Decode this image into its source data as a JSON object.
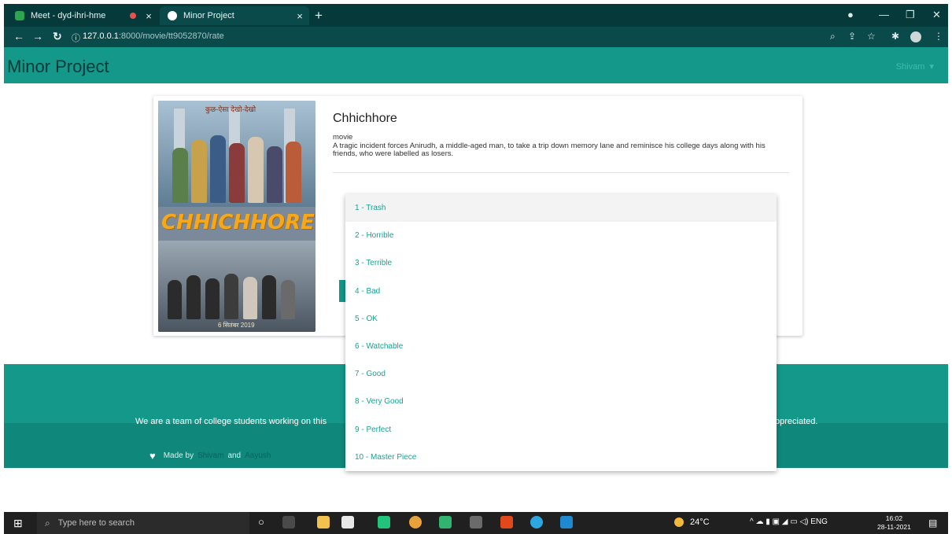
{
  "browser": {
    "tabs": [
      {
        "label": "Meet - dyd-ihri-hme"
      },
      {
        "label": "Minor Project"
      }
    ],
    "url_host": "127.0.0.1",
    "url_path": ":8000/movie/tt9052870/rate",
    "icons": [
      "back-arrow",
      "forward-arrow",
      "reload",
      "info",
      "zoom",
      "share",
      "star",
      "extensions",
      "profile",
      "menu"
    ]
  },
  "app": {
    "brand": "Minor Project",
    "user": "Shivam"
  },
  "movie": {
    "title": "Chhichhore",
    "type": "movie",
    "description": "A tragic incident forces Anirudh, a middle-aged man, to take a trip down memory lane and reminisce his college days along with his friends, who were labelled as losers.",
    "poster": {
      "title": "CHHICHHORE",
      "top_text": "कुछ-ऐसा देखो-देखो",
      "date": "6 सितंबर 2019"
    }
  },
  "rating_options": [
    "1 - Trash",
    "2 - Horrible",
    "3 - Terrible",
    "4 - Bad",
    "5 - OK",
    "6 - Watchable",
    "7 - Good",
    "8 - Very Good",
    "9 - Perfect",
    "10 - Master Piece"
  ],
  "footer": {
    "text_left": "We are a team of college students working on this",
    "text_right": "ppreciated.",
    "made_by": "Made by",
    "author1": "Shivam",
    "and": "and",
    "author2": "Aayush"
  },
  "taskbar": {
    "search_placeholder": "Type here to search",
    "temperature": "24°C",
    "lang": "ENG",
    "time": "16:02",
    "date": "28-11-2021"
  },
  "colors": {
    "primary": "#14988a",
    "dark": "#063a3a",
    "option_text": "#17a293"
  }
}
